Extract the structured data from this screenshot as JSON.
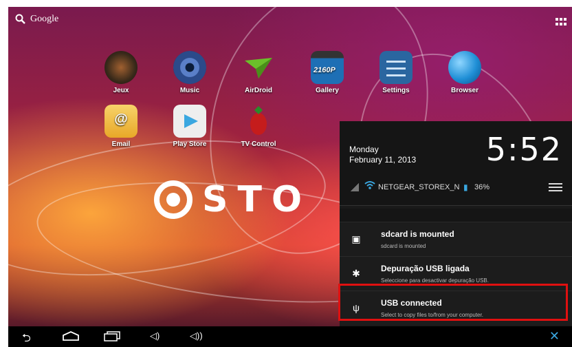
{
  "search": {
    "label": "Google"
  },
  "apps": [
    {
      "label": "Jeux",
      "icon": "games-icon",
      "color": "#3a2a1a"
    },
    {
      "label": "Music",
      "icon": "music-icon",
      "color": "#2b4a8a"
    },
    {
      "label": "AirDroid",
      "icon": "airdroid-icon",
      "color": "#6bbf2a"
    },
    {
      "label": "Gallery",
      "icon": "gallery-icon",
      "color": "#1e6fb5"
    },
    {
      "label": "Settings",
      "icon": "settings-icon",
      "color": "#2a66a0"
    },
    {
      "label": "Browser",
      "icon": "browser-icon",
      "color": "#1f8fd6"
    },
    {
      "label": "Email",
      "icon": "email-icon",
      "color": "#f3c24a"
    },
    {
      "label": "Play Store",
      "icon": "play-store-icon",
      "color": "#eeeeee"
    },
    {
      "label": "TV Control",
      "icon": "tv-control-icon",
      "color": "#c51c1c"
    }
  ],
  "gallery_badge": "2160P",
  "wallpaper_logo": "STO",
  "panel": {
    "day": "Monday",
    "date": "February 11, 2013",
    "time": "5:52",
    "network": "NETGEAR_STOREX_N",
    "battery": "36%"
  },
  "notifications": [
    {
      "title": "sdcard is mounted",
      "subtitle": "sdcard is mounted",
      "icon": "sdcard-icon"
    },
    {
      "title": "Depuração USB ligada",
      "subtitle": "Seleccione para desactivar depuração USB.",
      "icon": "android-debug-icon"
    },
    {
      "title": "USB connected",
      "subtitle": "Select to copy files to/from your computer.",
      "icon": "usb-icon"
    }
  ],
  "colors": {
    "accent": "#3aa7e0",
    "highlight": "#e01010"
  }
}
